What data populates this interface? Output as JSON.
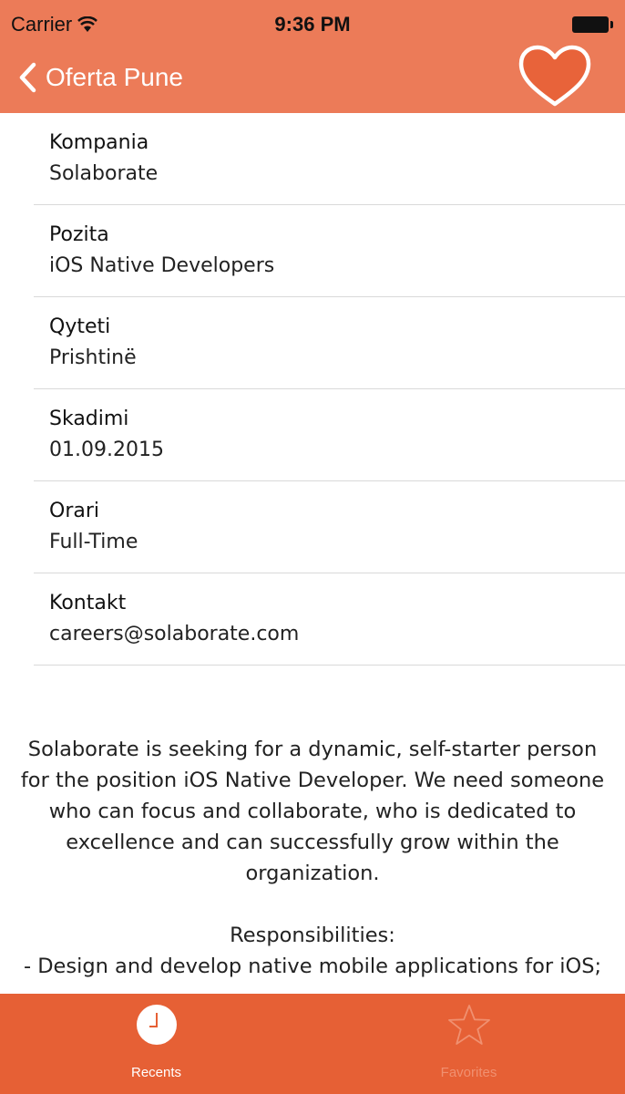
{
  "status_bar": {
    "carrier": "Carrier",
    "time": "9:36 PM"
  },
  "nav": {
    "back_label": "Oferta Pune"
  },
  "details": [
    {
      "label": "Kompania",
      "value": "Solaborate"
    },
    {
      "label": "Pozita",
      "value": "iOS Native Developers"
    },
    {
      "label": "Qyteti",
      "value": "Prishtinë"
    },
    {
      "label": "Skadimi",
      "value": "01.09.2015"
    },
    {
      "label": "Orari",
      "value": "Full-Time"
    },
    {
      "label": "Kontakt",
      "value": "careers@solaborate.com"
    }
  ],
  "description": {
    "intro": "Solaborate is seeking for a dynamic, self-starter person for the position iOS Native Developer. We need someone who can focus and collaborate, who is dedicated to excellence and can successfully grow within the organization.",
    "heading": "Responsibilities:",
    "item1": "- Design and develop native mobile applications for iOS;"
  },
  "tab_bar": {
    "recents": "Recents",
    "favorites": "Favorites",
    "colors": {
      "bar": "#e66035",
      "header": "#ec7b58",
      "inactive": "#f09070"
    }
  }
}
